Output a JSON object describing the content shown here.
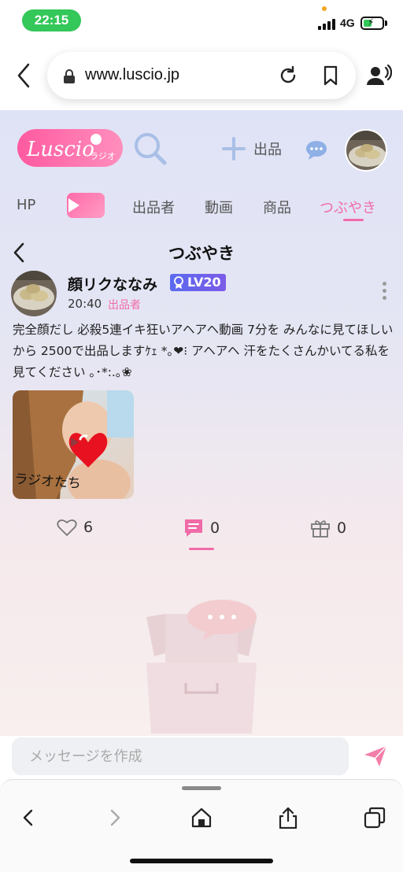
{
  "status_bar": {
    "time": "22:15",
    "network": "4G"
  },
  "browser": {
    "url": "www.luscio.jp"
  },
  "app": {
    "logo_text": "Luscio",
    "logo_sub": "ラジオ",
    "post_label": "出品",
    "tabs": [
      {
        "label": "HP"
      },
      {
        "label": "出品者"
      },
      {
        "label": "動画"
      },
      {
        "label": "商品"
      },
      {
        "label": "つぶやき"
      }
    ],
    "section_title": "つぶやき"
  },
  "post": {
    "author": "顔リクななみ",
    "level": "LV20",
    "time": "20:40",
    "role": "出品者",
    "body": "完全顔だし 必殺5連イキ狂いアヘアヘ動画 7分を みんなに見てほしいから 2500で出品しますｹｪ *｡❤︎⁝ アヘアヘ 汗をたくさんかいてる私を見てください ｡･*:.｡❀",
    "image_caption": "ラジオたち",
    "likes": "6",
    "comments": "0",
    "gifts": "0"
  },
  "composer": {
    "placeholder": "メッセージを作成"
  },
  "colors": {
    "accent_pink": "#f06ba8",
    "badge_purple": "#5b6bf0",
    "status_green": "#34c759"
  }
}
